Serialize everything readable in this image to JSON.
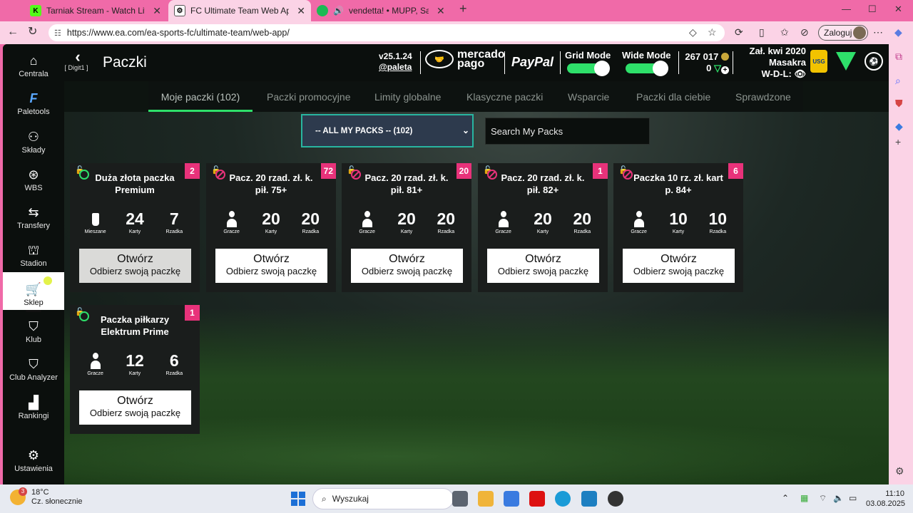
{
  "browser": {
    "tabs": [
      {
        "title": "Tarniak Stream - Watch Live on Ki",
        "fav": "K"
      },
      {
        "title": "FC Ultimate Team Web App - EA S",
        "fav": "⚙"
      },
      {
        "title": "vendetta! • MUPP, Sadfriend",
        "fav": ""
      }
    ],
    "url": "https://www.ea.com/ea-sports-fc/ultimate-team/web-app/",
    "login_label": "Zaloguj"
  },
  "sidebar": {
    "items": [
      {
        "label": "Centrala",
        "icon": "home-icon"
      },
      {
        "label": "Paletools",
        "icon": "paletools-icon"
      },
      {
        "label": "Składy",
        "icon": "squad-icon"
      },
      {
        "label": "WBS",
        "icon": "wbs-icon"
      },
      {
        "label": "Transfery",
        "icon": "transfers-icon"
      },
      {
        "label": "Stadion",
        "icon": "stadium-icon"
      },
      {
        "label": "Sklep",
        "icon": "store-icon"
      },
      {
        "label": "Klub",
        "icon": "club-icon"
      },
      {
        "label": "Club Analyzer",
        "icon": "club-analyzer-icon"
      },
      {
        "label": "Rankingi",
        "icon": "rankings-icon"
      },
      {
        "label": "Ustawienia",
        "icon": "settings-icon"
      }
    ]
  },
  "header": {
    "back_label": "[ Digit1 ]",
    "title": "Paczki",
    "version": "v25.1.24",
    "handle": "@paleta",
    "mercado": "mercado",
    "pago": "pago",
    "paypal": "PayPal",
    "grid_mode": "Grid Mode",
    "wide_mode": "Wide Mode",
    "coins": "267 017",
    "points": "0",
    "joined": "Zał. kwi 2020",
    "club_name": "Masakra",
    "wdl": "W-D-L:",
    "logo_text": "USG"
  },
  "tabs": [
    "Moje paczki (102)",
    "Paczki promocyjne",
    "Limity globalne",
    "Klasyczne paczki",
    "Wsparcie",
    "Paczki dla ciebie",
    "Sprawdzone"
  ],
  "filter": {
    "select_value": "-- ALL MY PACKS -- (102)",
    "search_placeholder": "Search My Packs"
  },
  "packs": [
    {
      "name": "Duża złota paczka Premium",
      "count": "2",
      "tradeable": true,
      "s1": "",
      "s1_label": "Mieszane",
      "s2": "24",
      "s2_label": "Karty",
      "s3": "7",
      "s3_label": "Rzadka",
      "open": "Otwórz",
      "claim": "Odbierz swoją paczkę"
    },
    {
      "name": "Pacz. 20 rzad. zł. k. pił. 75+",
      "count": "72",
      "tradeable": false,
      "s1": "",
      "s1_label": "Gracze",
      "s2": "20",
      "s2_label": "Karty",
      "s3": "20",
      "s3_label": "Rzadka",
      "open": "Otwórz",
      "claim": "Odbierz swoją paczkę"
    },
    {
      "name": "Pacz. 20 rzad. zł. k. pił. 81+",
      "count": "20",
      "tradeable": false,
      "s1": "",
      "s1_label": "Gracze",
      "s2": "20",
      "s2_label": "Karty",
      "s3": "20",
      "s3_label": "Rzadka",
      "open": "Otwórz",
      "claim": "Odbierz swoją paczkę"
    },
    {
      "name": "Pacz. 20 rzad. zł. k. pił. 82+",
      "count": "1",
      "tradeable": false,
      "s1": "",
      "s1_label": "Gracze",
      "s2": "20",
      "s2_label": "Karty",
      "s3": "20",
      "s3_label": "Rzadka",
      "open": "Otwórz",
      "claim": "Odbierz swoją paczkę"
    },
    {
      "name": "Paczka 10 rz. zł. kart p. 84+",
      "count": "6",
      "tradeable": false,
      "s1": "",
      "s1_label": "Gracze",
      "s2": "10",
      "s2_label": "Karty",
      "s3": "10",
      "s3_label": "Rzadka",
      "open": "Otwórz",
      "claim": "Odbierz swoją paczkę"
    },
    {
      "name": "Paczka piłkarzy Elektrum Prime",
      "count": "1",
      "tradeable": true,
      "s1": "",
      "s1_label": "Gracze",
      "s2": "12",
      "s2_label": "Karty",
      "s3": "6",
      "s3_label": "Rzadka",
      "open": "Otwórz",
      "claim": "Odbierz swoją paczkę"
    }
  ],
  "taskbar": {
    "temp": "18°C",
    "weather": "Cz. słonecznie",
    "weather_badge": "3",
    "search": "Wyszukaj",
    "time": "11:10",
    "date": "03.08.2025"
  }
}
